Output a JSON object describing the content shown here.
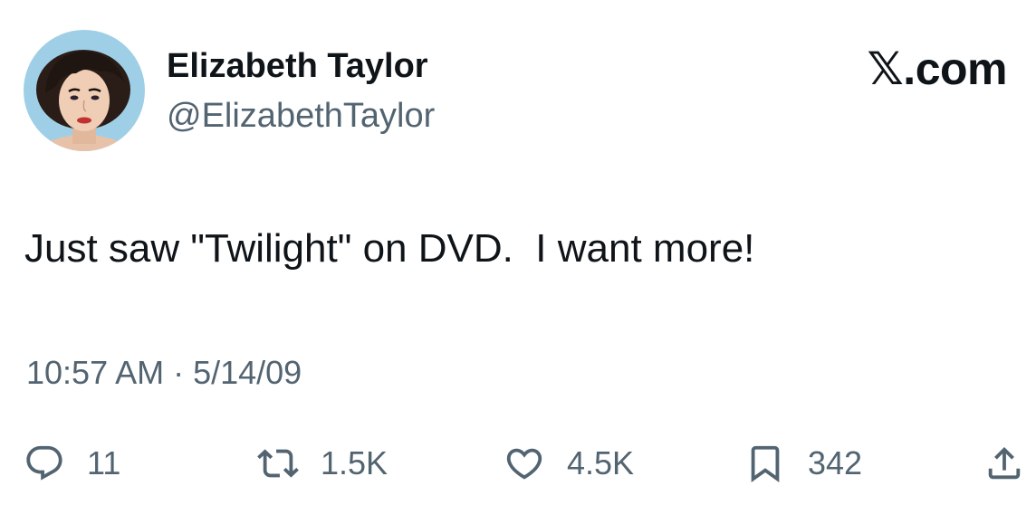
{
  "user": {
    "display_name": "Elizabeth Taylor",
    "handle": "@ElizabethTaylor",
    "avatar": "profile-photo"
  },
  "brand": {
    "label": "𝕏.com",
    "icon": "x-logo"
  },
  "tweet": {
    "text": "Just saw \"Twilight\" on DVD.  I want more!",
    "timestamp": "10:57 AM · 5/14/09"
  },
  "actions": {
    "reply": {
      "icon": "speech-bubble-icon",
      "count": "11"
    },
    "retweet": {
      "icon": "retweet-icon",
      "count": "1.5K"
    },
    "like": {
      "icon": "heart-icon",
      "count": "4.5K"
    },
    "bookmark": {
      "icon": "bookmark-icon",
      "count": "342"
    },
    "share": {
      "icon": "share-icon"
    }
  },
  "colors": {
    "primary_text": "#0f1419",
    "secondary_text": "#536471",
    "background": "#ffffff",
    "avatar_bg": "#9fcfe6"
  }
}
